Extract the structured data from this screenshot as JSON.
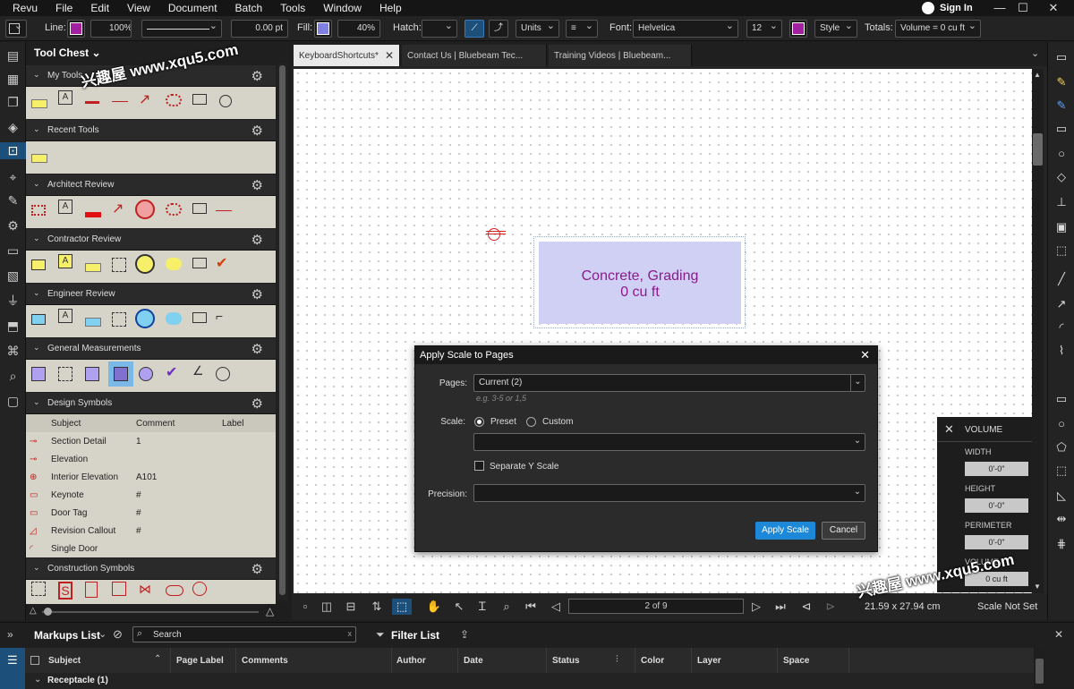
{
  "menu": [
    "Revu",
    "File",
    "Edit",
    "View",
    "Document",
    "Batch",
    "Tools",
    "Window",
    "Help"
  ],
  "signin": "Sign In",
  "toolbar": {
    "line_label": "Line:",
    "line_color": "#a020a0",
    "line_opacity": "100%",
    "line_width": "0.00 pt",
    "fill_label": "Fill:",
    "fill_color": "#8080e0",
    "fill_opacity": "40%",
    "hatch_label": "Hatch:",
    "units": "Units",
    "font_label": "Font:",
    "font": "Helvetica",
    "font_size": "12",
    "text_color": "#a020a0",
    "style": "Style",
    "totals_label": "Totals:",
    "totals": "Volume = 0 cu ft"
  },
  "toolchest": {
    "title": "Tool Chest",
    "sections": [
      "My Tools",
      "Recent Tools",
      "Architect Review",
      "Contractor Review",
      "Engineer Review",
      "General Measurements",
      "Design Symbols",
      "Construction Symbols"
    ],
    "design_symbols": {
      "columns": [
        "Subject",
        "Comment",
        "Label"
      ],
      "rows": [
        {
          "subject": "Section Detail",
          "comment": "1"
        },
        {
          "subject": "Elevation",
          "comment": ""
        },
        {
          "subject": "Interior Elevation",
          "comment": "A101"
        },
        {
          "subject": "Keynote",
          "comment": "#"
        },
        {
          "subject": "Door Tag",
          "comment": "#"
        },
        {
          "subject": "Revision Callout",
          "comment": "#"
        },
        {
          "subject": "Single Door",
          "comment": ""
        }
      ]
    }
  },
  "tabs": [
    "KeyboardShortcuts*",
    "Contact Us | Bluebeam Tec...",
    "Training Videos | Bluebeam..."
  ],
  "canvas": {
    "markup_line1": "Concrete, Grading",
    "markup_line2": "0 cu ft",
    "markup_text_color": "#8b1a8b",
    "markup_fill": "#d0d0f5"
  },
  "status": {
    "page": "2 of 9",
    "size": "21.59 x 27.94 cm",
    "scale": "Scale Not Set"
  },
  "watermark": "兴趣屋 www.xqu5.com",
  "volume_panel": {
    "title": "VOLUME",
    "width_label": "WIDTH",
    "width": "0'-0\"",
    "height_label": "HEIGHT",
    "height": "0'-0\"",
    "perimeter_label": "PERIMETER",
    "perimeter": "0'-0\"",
    "volume_label": "VOLUME",
    "volume": "0 cu ft"
  },
  "dialog": {
    "title": "Apply Scale to Pages",
    "pages_label": "Pages:",
    "pages_value": "Current (2)",
    "pages_hint": "e.g. 3-5 or 1,5",
    "scale_label": "Scale:",
    "preset": "Preset",
    "custom": "Custom",
    "separate_y": "Separate Y Scale",
    "precision_label": "Precision:",
    "apply": "Apply Scale",
    "cancel": "Cancel"
  },
  "markups": {
    "title": "Markups List",
    "search_placeholder": "Search",
    "filter": "Filter List",
    "columns": [
      "Subject",
      "Page Label",
      "Comments",
      "Author",
      "Date",
      "Status",
      "Color",
      "Layer",
      "Space"
    ],
    "group": "Receptacle (1)"
  }
}
